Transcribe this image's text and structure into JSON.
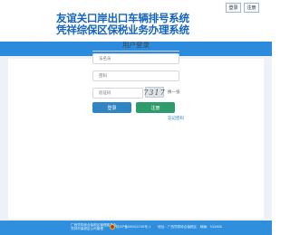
{
  "header": {
    "title_line1": "友谊关口岸出口车辆排号系统",
    "title_line2": "凭祥综保区保税业务办理系统",
    "login_button": "登录",
    "register_button": "注册"
  },
  "login": {
    "title": "用户登录",
    "username_placeholder": "法名员",
    "password_placeholder": "密码",
    "captcha_placeholder": "验证码",
    "captcha_code": "7317",
    "refresh_label": "换一张",
    "login_button": "登录",
    "register_button": "注册",
    "forgot_password": "忘记密码"
  },
  "footer": {
    "left_line1": "广西凭祥综合保税区管理委员会",
    "left_line2": "凭祥市保税区公司管理",
    "mid_text": "桂ICP备08002039号-1",
    "right_text": "地址：广西凭祥综合保税区　邮编：532600"
  },
  "colors": {
    "brand_blue": "#1565c0",
    "band_blue": "#2c8bdc",
    "login_blue": "#2f84c4",
    "register_green": "#2e9c6a"
  }
}
